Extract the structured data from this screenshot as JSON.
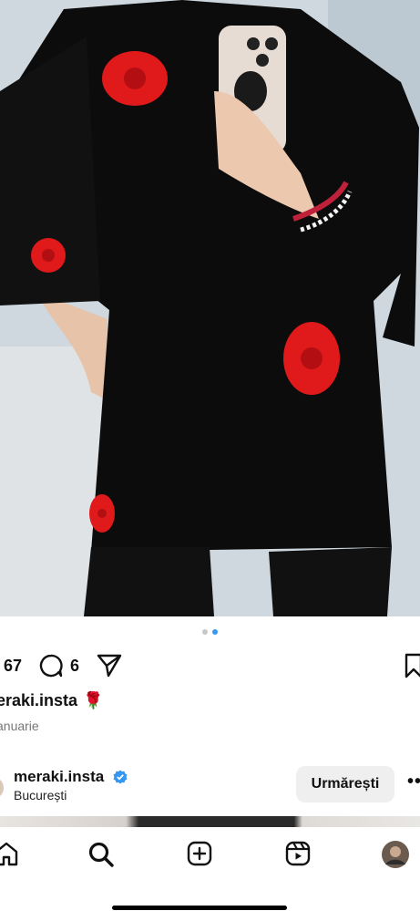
{
  "post": {
    "likes_count": "67",
    "comments_count": "6",
    "caption_user": "eraki.insta",
    "caption_emoji": "🌹",
    "date": "anuarie"
  },
  "carousel": {
    "total": 2,
    "active": 2
  },
  "suggested": {
    "username": "meraki.insta",
    "location": "București",
    "follow_label": "Urmărești",
    "more_label": "•••"
  },
  "colors": {
    "accent": "#3897f0",
    "verified": "#3797f0",
    "rose": "#e0191a"
  },
  "icons": {
    "comment": "comment-icon",
    "share": "send-icon",
    "save": "bookmark-icon",
    "home": "home-icon",
    "search": "search-icon",
    "create": "plus-square-icon",
    "reels": "reels-icon",
    "profile": "avatar"
  }
}
